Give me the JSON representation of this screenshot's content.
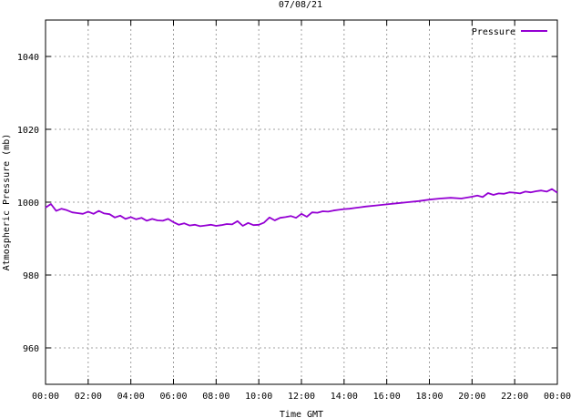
{
  "chart_data": {
    "type": "line",
    "title": "07/08/21",
    "xlabel": "Time GMT",
    "ylabel": "Atmospheric Pressure (mb)",
    "ylim": [
      950,
      1050
    ],
    "xlim": [
      0,
      24
    ],
    "grid": true,
    "legend_position": "top-right",
    "x_ticks": [
      {
        "x": 0,
        "label": "00:00"
      },
      {
        "x": 2,
        "label": "02:00"
      },
      {
        "x": 4,
        "label": "04:00"
      },
      {
        "x": 6,
        "label": "06:00"
      },
      {
        "x": 8,
        "label": "08:00"
      },
      {
        "x": 10,
        "label": "10:00"
      },
      {
        "x": 12,
        "label": "12:00"
      },
      {
        "x": 14,
        "label": "14:00"
      },
      {
        "x": 16,
        "label": "16:00"
      },
      {
        "x": 18,
        "label": "18:00"
      },
      {
        "x": 20,
        "label": "20:00"
      },
      {
        "x": 22,
        "label": "22:00"
      },
      {
        "x": 24,
        "label": "00:00"
      }
    ],
    "y_ticks": [
      {
        "y": 960,
        "label": "960"
      },
      {
        "y": 980,
        "label": "980"
      },
      {
        "y": 1000,
        "label": "1000"
      },
      {
        "y": 1020,
        "label": "1020"
      },
      {
        "y": 1040,
        "label": "1040"
      }
    ],
    "series": [
      {
        "name": "Pressure",
        "color": "#9400d3",
        "x": [
          0,
          0.25,
          0.5,
          0.75,
          1.0,
          1.25,
          1.5,
          1.75,
          2.0,
          2.25,
          2.5,
          2.75,
          3.0,
          3.25,
          3.5,
          3.75,
          4.0,
          4.25,
          4.5,
          4.75,
          5.0,
          5.25,
          5.5,
          5.75,
          6.0,
          6.25,
          6.5,
          6.75,
          7.0,
          7.25,
          7.5,
          7.75,
          8.0,
          8.25,
          8.5,
          8.75,
          9.0,
          9.25,
          9.5,
          9.75,
          10.0,
          10.25,
          10.5,
          10.75,
          11.0,
          11.25,
          11.5,
          11.75,
          12.0,
          12.25,
          12.5,
          12.75,
          13.0,
          13.25,
          13.5,
          13.75,
          14.0,
          14.25,
          14.5,
          14.75,
          15.0,
          15.5,
          16.0,
          16.5,
          17.0,
          17.5,
          18.0,
          18.5,
          19.0,
          19.5,
          20.0,
          20.25,
          20.5,
          20.75,
          21.0,
          21.25,
          21.5,
          21.75,
          22.0,
          22.25,
          22.5,
          22.75,
          23.0,
          23.25,
          23.5,
          23.75,
          24.0
        ],
        "values": [
          998.5,
          999.5,
          997.6,
          998.2,
          997.8,
          997.2,
          997.0,
          996.8,
          997.4,
          996.8,
          997.6,
          996.9,
          996.7,
          995.8,
          996.3,
          995.4,
          995.9,
          995.3,
          995.7,
          994.9,
          995.4,
          995.0,
          994.9,
          995.4,
          994.5,
          993.8,
          994.2,
          993.6,
          993.8,
          993.4,
          993.6,
          993.8,
          993.5,
          993.7,
          994.0,
          993.9,
          994.8,
          993.5,
          994.3,
          993.7,
          993.8,
          994.4,
          995.8,
          995.0,
          995.7,
          995.9,
          996.2,
          995.7,
          996.8,
          996.0,
          997.2,
          997.1,
          997.5,
          997.4,
          997.7,
          997.9,
          998.1,
          998.2,
          998.4,
          998.6,
          998.8,
          999.1,
          999.4,
          999.7,
          1000.0,
          1000.3,
          1000.7,
          1001.0,
          1001.2,
          1001.0,
          1001.5,
          1001.8,
          1001.4,
          1002.5,
          1002.0,
          1002.4,
          1002.3,
          1002.7,
          1002.6,
          1002.4,
          1002.9,
          1002.7,
          1003.0,
          1003.2,
          1002.9,
          1003.6,
          1002.6
        ]
      }
    ]
  }
}
